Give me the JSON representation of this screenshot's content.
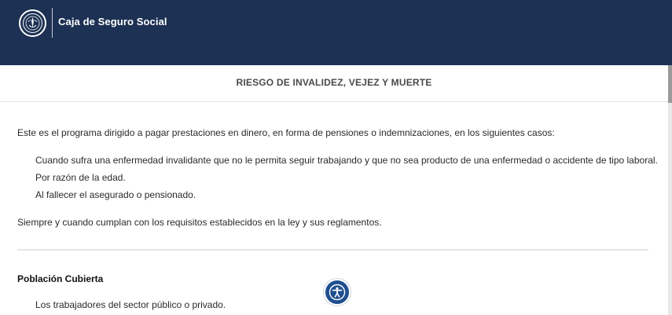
{
  "header": {
    "brand_name": "Caja de Seguro Social",
    "logo_icon": "css-seal-logo-icon",
    "background_color": "#1c3153"
  },
  "page": {
    "title": "RIESGO DE INVALIDEZ, VEJEZ Y MUERTE"
  },
  "body": {
    "intro": "Este es el programa dirigido a pagar prestaciones en dinero, en forma de pensiones o indemnizaciones, en los siguientes casos:",
    "cases": [
      "Cuando sufra una enfermedad invalidante que no le permita seguir trabajando y que no sea producto de una enfermedad o accidente de tipo laboral.",
      "Por razón de la edad.",
      "Al fallecer el asegurado o pensionado."
    ],
    "closing": "Siempre y cuando cumplan con los requisitos establecidos en la ley y sus reglamentos."
  },
  "coverage": {
    "heading": "Población Cubierta",
    "items": [
      "Los trabajadores del sector público o privado."
    ]
  },
  "accessibility": {
    "icon": "accessibility-person-icon",
    "accent_color": "#1f4f8f"
  }
}
